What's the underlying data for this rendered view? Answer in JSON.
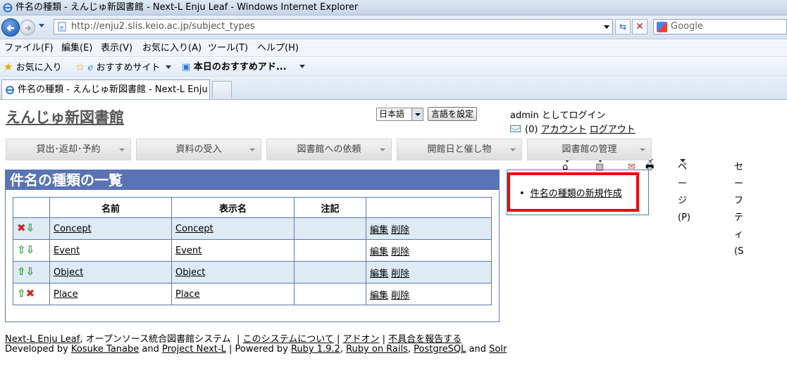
{
  "window": {
    "title": "件名の種類 - えんじゅ新図書館 - Next-L Enju Leaf - Windows Internet Explorer"
  },
  "addressbar": {
    "url": "http://enju2.slis.keio.ac.jp/subject_types",
    "search_placeholder": "Google"
  },
  "menubar": {
    "items": [
      "ファイル(F)",
      "編集(E)",
      "表示(V)",
      "お気に入り(A)",
      "ツール(T)",
      "ヘルプ(H)"
    ]
  },
  "favorites": {
    "favorites_label": "お気に入り",
    "suggested_sites": "おすすめサイト",
    "web_slice": "本日のおすすめアド..."
  },
  "tabs": {
    "active": "件名の種類 - えんじゅ新図書館 - Next-L Enju ..."
  },
  "commandbar": {
    "page": "ページ(P)",
    "safety": "セーフティ(S"
  },
  "site": {
    "title": "えんじゅ新図書館",
    "language_value": "日本語",
    "language_button": "言語を設定",
    "login_text": "admin としてログイン",
    "message_count": "(0)",
    "account": "アカウント",
    "logout": "ログアウト"
  },
  "nav": [
    "貸出･返却･予約",
    "資料の受入",
    "図書館への依頼",
    "開館日と催し物",
    "図書館の管理"
  ],
  "main": {
    "heading": "件名の種類の一覧",
    "columns": [
      "",
      "名前",
      "表示名",
      "注記",
      ""
    ],
    "rows": [
      {
        "name": "Concept",
        "display_name": "Concept",
        "note": "",
        "edit": "編集",
        "delete": "削除",
        "icons": [
          "x",
          "down"
        ]
      },
      {
        "name": "Event",
        "display_name": "Event",
        "note": "",
        "edit": "編集",
        "delete": "削除",
        "icons": [
          "up",
          "down"
        ]
      },
      {
        "name": "Object",
        "display_name": "Object",
        "note": "",
        "edit": "編集",
        "delete": "削除",
        "icons": [
          "up",
          "down"
        ]
      },
      {
        "name": "Place",
        "display_name": "Place",
        "note": "",
        "edit": "編集",
        "delete": "削除",
        "icons": [
          "up",
          "x"
        ]
      }
    ]
  },
  "sidebar": {
    "new_link": "件名の種類の新規作成"
  },
  "footer": {
    "line1": {
      "product": "Next-L Enju Leaf",
      "desc": ", オープンソース統合図書館システム",
      "about": "このシステムについて",
      "addon": "アドオン",
      "report": "不具合を報告する"
    },
    "line2": {
      "developed_by": "Developed by",
      "author": "Kosuke Tanabe",
      "and": "and",
      "project": "Project Next-L",
      "powered_by": "| Powered by",
      "ruby": "Ruby 1.9.2",
      "rails": "Ruby on Rails",
      "postgres": "PostgreSQL",
      "solr": "Solr"
    }
  },
  "colors": {
    "heading_bg": "#5a73b4",
    "border": "#5a7ab5",
    "row_alt": "#deeaf4",
    "highlight": "#ee0a0a"
  }
}
